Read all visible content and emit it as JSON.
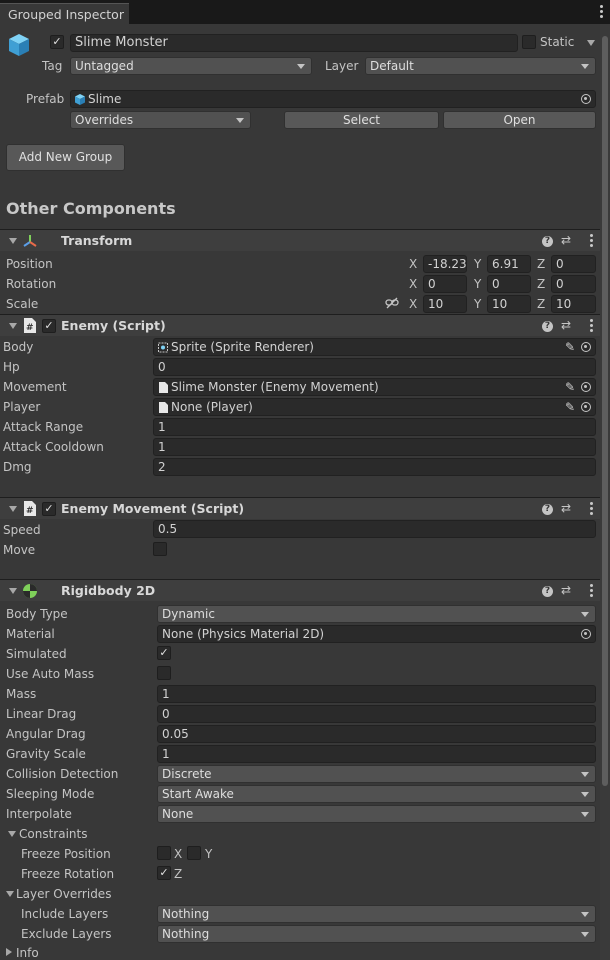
{
  "tab": {
    "title": "Grouped Inspector"
  },
  "object": {
    "name": "Slime Monster",
    "static_label": "Static",
    "tag_label": "Tag",
    "tag_value": "Untagged",
    "layer_label": "Layer",
    "layer_value": "Default",
    "prefab_label": "Prefab",
    "prefab_value": "Slime",
    "overrides_value": "Overrides",
    "select_label": "Select",
    "open_label": "Open"
  },
  "add_group_label": "Add New Group",
  "other_components_title": "Other Components",
  "transform": {
    "title": "Transform",
    "rows": [
      {
        "label": "Position",
        "x": "-18.23",
        "y": "6.91",
        "z": "0"
      },
      {
        "label": "Rotation",
        "x": "0",
        "y": "0",
        "z": "0"
      },
      {
        "label": "Scale",
        "x": "10",
        "y": "10",
        "z": "10"
      }
    ],
    "axis": {
      "x": "X",
      "y": "Y",
      "z": "Z"
    }
  },
  "enemy": {
    "title": "Enemy (Script)",
    "rows": [
      {
        "label": "Body",
        "value": "Sprite (Sprite Renderer)"
      },
      {
        "label": "Hp",
        "value": "0"
      },
      {
        "label": "Movement",
        "value": "Slime Monster (Enemy Movement)"
      },
      {
        "label": "Player",
        "value": "None (Player)"
      },
      {
        "label": "Attack Range",
        "value": "1"
      },
      {
        "label": "Attack Cooldown",
        "value": "1"
      },
      {
        "label": "Dmg",
        "value": "2"
      }
    ]
  },
  "enemy_movement": {
    "title": "Enemy Movement (Script)",
    "speed_label": "Speed",
    "speed_value": "0.5",
    "move_label": "Move"
  },
  "rigidbody": {
    "title": "Rigidbody 2D",
    "body_type_label": "Body Type",
    "body_type_value": "Dynamic",
    "material_label": "Material",
    "material_value": "None (Physics Material 2D)",
    "simulated_label": "Simulated",
    "use_auto_mass_label": "Use Auto Mass",
    "mass_label": "Mass",
    "mass_value": "1",
    "linear_drag_label": "Linear Drag",
    "linear_drag_value": "0",
    "angular_drag_label": "Angular Drag",
    "angular_drag_value": "0.05",
    "gravity_scale_label": "Gravity Scale",
    "gravity_scale_value": "1",
    "collision_detection_label": "Collision Detection",
    "collision_detection_value": "Discrete",
    "sleeping_mode_label": "Sleeping Mode",
    "sleeping_mode_value": "Start Awake",
    "interpolate_label": "Interpolate",
    "interpolate_value": "None",
    "constraints_label": "Constraints",
    "freeze_position_label": "Freeze Position",
    "freeze_rotation_label": "Freeze Rotation",
    "fx": "X",
    "fy": "Y",
    "fz": "Z",
    "layer_overrides_label": "Layer Overrides",
    "include_layers_label": "Include Layers",
    "include_layers_value": "Nothing",
    "exclude_layers_label": "Exclude Layers",
    "exclude_layers_value": "Nothing",
    "info_label": "Info"
  }
}
